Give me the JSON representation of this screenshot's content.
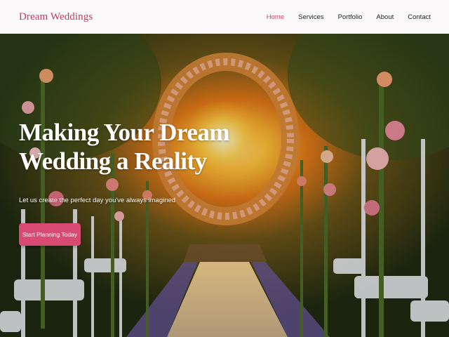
{
  "brand": {
    "name": "Dream Weddings",
    "accent": "#c33a5e"
  },
  "nav": {
    "items": [
      {
        "label": "Home",
        "active": true
      },
      {
        "label": "Services",
        "active": false
      },
      {
        "label": "Portfolio",
        "active": false
      },
      {
        "label": "About",
        "active": false
      },
      {
        "label": "Contact",
        "active": false
      }
    ],
    "active_color": "#d1416d"
  },
  "hero": {
    "title": "Making Your Dream Wedding a Reality",
    "subtitle": "Let us create the perfect day you've always imagined",
    "cta_label": "Start Planning Today",
    "cta_color": "#d84a72",
    "background": "wedding-aisle-floral-arch-sunset-image"
  }
}
